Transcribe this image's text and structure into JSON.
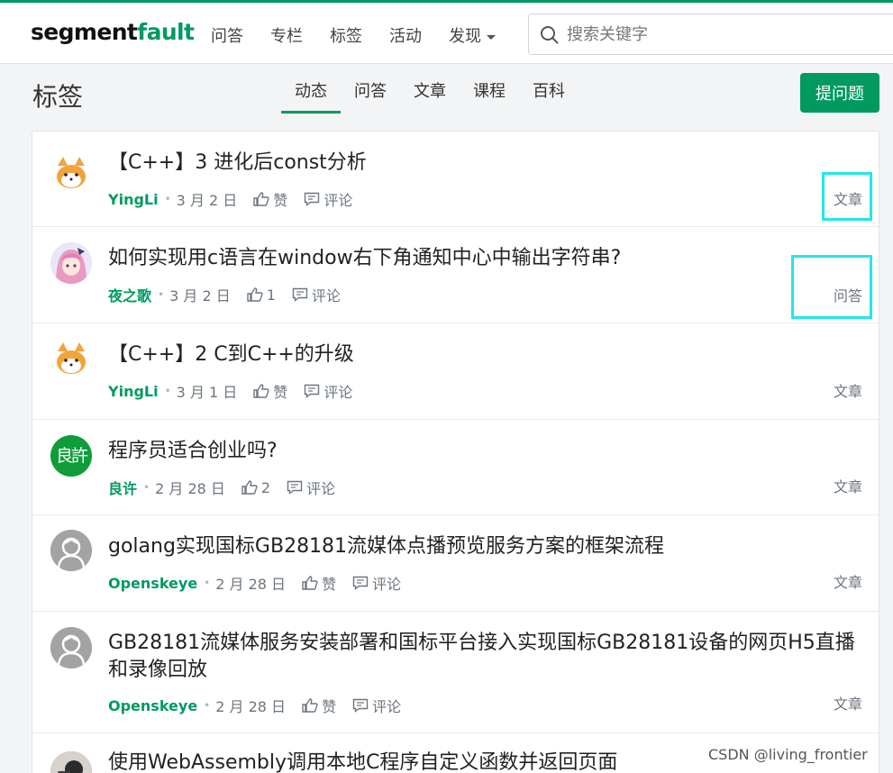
{
  "brand": {
    "logo_main": "segment",
    "logo_accent": "fault"
  },
  "nav": {
    "items": [
      "问答",
      "专栏",
      "标签",
      "活动"
    ],
    "discover": "发现",
    "search_placeholder": "搜索关键字"
  },
  "header": {
    "title": "标签",
    "tabs": [
      "动态",
      "问答",
      "文章",
      "课程",
      "百科"
    ],
    "active_tab": "动态",
    "ask_button": "提问题"
  },
  "feed": [
    {
      "title": "【C++】3 进化后const分析",
      "author": "YingLi",
      "date": "3 月 2 日",
      "votes": "赞",
      "comments": "评论",
      "type": "文章",
      "avatar": "shiba-cat-icon"
    },
    {
      "title": "如何实现用c语言在window右下角通知中心中输出字符串?",
      "author": "夜之歌",
      "date": "3 月 2 日",
      "votes": "1",
      "comments": "评论",
      "type": "问答",
      "avatar": "anime-girl-icon"
    },
    {
      "title": "【C++】2 C到C++的升级",
      "author": "YingLi",
      "date": "3 月 1 日",
      "votes": "赞",
      "comments": "评论",
      "type": "文章",
      "avatar": "shiba-cat-icon"
    },
    {
      "title": "程序员适合创业吗?",
      "author": "良许",
      "date": "2 月 28 日",
      "votes": "2",
      "comments": "评论",
      "type": "文章",
      "avatar": "liangxu-badge",
      "avatar_text": "良許"
    },
    {
      "title": "golang实现国标GB28181流媒体点播预览服务方案的框架流程",
      "author": "Openskeye",
      "date": "2 月 28 日",
      "votes": "赞",
      "comments": "评论",
      "type": "文章",
      "avatar": "default-user-icon"
    },
    {
      "title": "GB28181流媒体服务安装部署和国标平台接入实现国标GB28181设备的网页H5直播和录像回放",
      "author": "Openskeye",
      "date": "2 月 28 日",
      "votes": "赞",
      "comments": "评论",
      "type": "文章",
      "avatar": "default-user-icon"
    },
    {
      "title": "使用WebAssembly调用本地C程序自定义函数并返回页面",
      "author": "",
      "date": "",
      "votes": "",
      "comments": "",
      "type": "",
      "avatar": "photo-avatar"
    }
  ],
  "watermark": "CSDN @living_frontier",
  "colors": {
    "brand_green": "#009a61",
    "highlight_cyan": "#22e6f0"
  }
}
